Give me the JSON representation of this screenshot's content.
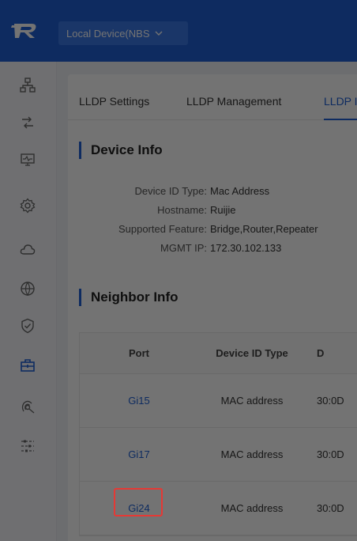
{
  "header": {
    "device_select_label": "Local Device(NBS"
  },
  "sidebar": {
    "icons": [
      "topology-icon",
      "switch-icon",
      "monitor-icon",
      "gear-icon",
      "cloud-icon",
      "globe-icon",
      "shield-check-icon",
      "toolbox-icon",
      "wireless-icon",
      "sliders-icon"
    ]
  },
  "tabs": [
    {
      "label": "LLDP Settings"
    },
    {
      "label": "LLDP Management"
    },
    {
      "label": "LLDP I"
    }
  ],
  "device_info": {
    "title": "Device Info",
    "rows": [
      {
        "label": "Device ID Type:",
        "value": "Mac Address"
      },
      {
        "label": "Hostname:",
        "value": "Ruijie"
      },
      {
        "label": "Supported Feature:",
        "value": "Bridge,Router,Repeater"
      },
      {
        "label": "MGMT IP:",
        "value": "172.30.102.133"
      }
    ]
  },
  "neighbor_info": {
    "title": "Neighbor Info",
    "columns": [
      "Port",
      "Device ID Type",
      "D"
    ],
    "rows": [
      {
        "port": "Gi15",
        "device_id_type": "MAC address",
        "device_id": "30:0D"
      },
      {
        "port": "Gi17",
        "device_id_type": "MAC address",
        "device_id": "30:0D"
      },
      {
        "port": "Gi24",
        "device_id_type": "MAC address",
        "device_id": "30:0D"
      }
    ]
  },
  "colors": {
    "brand_blue": "#1f61d6",
    "highlight_red": "#e53935"
  }
}
